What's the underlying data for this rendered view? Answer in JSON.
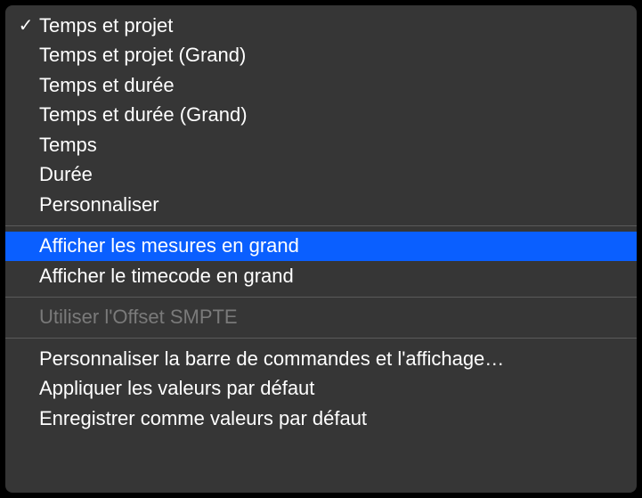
{
  "menu": {
    "sections": [
      {
        "items": [
          {
            "label": "Temps et projet",
            "checked": true,
            "highlighted": false,
            "disabled": false
          },
          {
            "label": "Temps et projet (Grand)",
            "checked": false,
            "highlighted": false,
            "disabled": false
          },
          {
            "label": "Temps et durée",
            "checked": false,
            "highlighted": false,
            "disabled": false
          },
          {
            "label": "Temps et durée (Grand)",
            "checked": false,
            "highlighted": false,
            "disabled": false
          },
          {
            "label": "Temps",
            "checked": false,
            "highlighted": false,
            "disabled": false
          },
          {
            "label": "Durée",
            "checked": false,
            "highlighted": false,
            "disabled": false
          },
          {
            "label": "Personnaliser",
            "checked": false,
            "highlighted": false,
            "disabled": false
          }
        ]
      },
      {
        "items": [
          {
            "label": "Afficher les mesures en grand",
            "checked": false,
            "highlighted": true,
            "disabled": false
          },
          {
            "label": "Afficher le timecode en grand",
            "checked": false,
            "highlighted": false,
            "disabled": false
          }
        ]
      },
      {
        "items": [
          {
            "label": "Utiliser l'Offset SMPTE",
            "checked": false,
            "highlighted": false,
            "disabled": true
          }
        ]
      },
      {
        "items": [
          {
            "label": "Personnaliser la barre de commandes et l'affichage…",
            "checked": false,
            "highlighted": false,
            "disabled": false
          },
          {
            "label": "Appliquer les valeurs par défaut",
            "checked": false,
            "highlighted": false,
            "disabled": false
          },
          {
            "label": "Enregistrer comme valeurs par défaut",
            "checked": false,
            "highlighted": false,
            "disabled": false
          }
        ]
      }
    ]
  },
  "icons": {
    "checkmark": "✓"
  }
}
